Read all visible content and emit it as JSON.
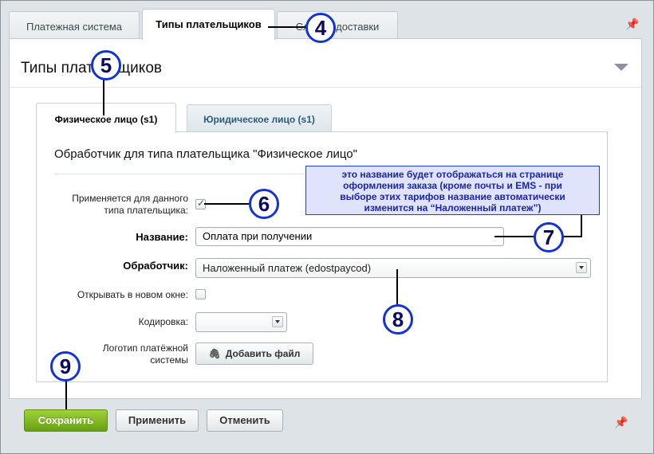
{
  "tabs": [
    {
      "label": "Платежная система"
    },
    {
      "label": "Типы плательщиков"
    },
    {
      "label": "Служба доставки"
    }
  ],
  "panel": {
    "title": "Типы плательщиков"
  },
  "inner_tabs": [
    {
      "label": "Физическое лицо (s1)"
    },
    {
      "label": "Юридическое лицо (s1)"
    }
  ],
  "form": {
    "title": "Обработчик для типа плательщика \"Физическое лицо\"",
    "applies_label_line1": "Применяется для данного",
    "applies_label_line2": "типа плательщика:",
    "applies_checked": true,
    "name_label": "Название:",
    "name_value": "Оплата при получении",
    "handler_label": "Обработчик:",
    "handler_value": "Наложенный платеж (edostpaycod)",
    "new_window_label": "Открывать в новом окне:",
    "new_window_checked": false,
    "encoding_label": "Кодировка:",
    "encoding_value": "",
    "logo_label_line1": "Логотип платёжной",
    "logo_label_line2": "системы",
    "add_file_label": "Добавить файл"
  },
  "buttons": {
    "save": "Сохранить",
    "apply": "Применить",
    "cancel": "Отменить"
  },
  "annotations": {
    "n4": "4",
    "n5": "5",
    "n6": "6",
    "n7": "7",
    "n8": "8",
    "n9": "9",
    "tooltip_line1": "это название будет отображаться на странице",
    "tooltip_line2": "оформления заказа (кроме почты и EMS - при",
    "tooltip_line3": "выборе этих тарифов название автоматически",
    "tooltip_line4": "изменится на “Наложенный платеж”)"
  },
  "colors": {
    "save_button": "#7cb51f",
    "annotation_circle": "#1133d6",
    "tooltip_bg": "#dfe3fb",
    "tooltip_text": "#1a23b5"
  }
}
